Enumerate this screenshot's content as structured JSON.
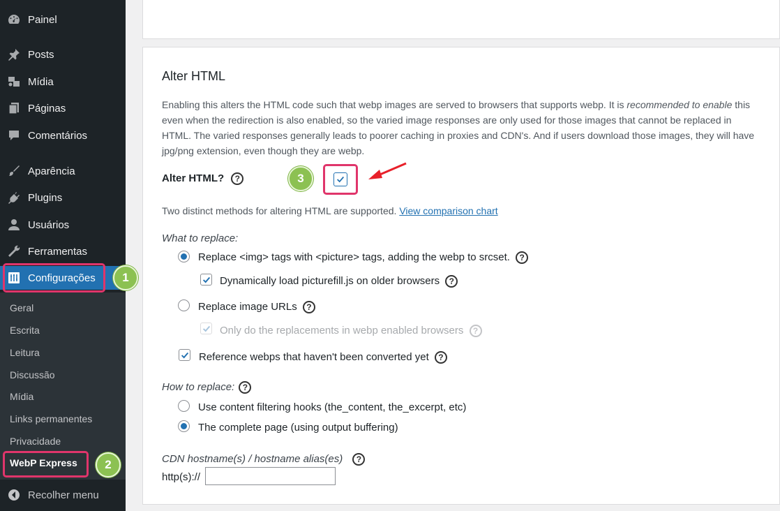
{
  "sidebar": {
    "items": [
      {
        "label": "Painel",
        "icon": "dashboard-icon"
      },
      {
        "label": "Posts",
        "icon": "pin-icon"
      },
      {
        "label": "Mídia",
        "icon": "media-icon"
      },
      {
        "label": "Páginas",
        "icon": "pages-icon"
      },
      {
        "label": "Comentários",
        "icon": "comments-icon"
      },
      {
        "label": "Aparência",
        "icon": "brush-icon"
      },
      {
        "label": "Plugins",
        "icon": "plugin-icon"
      },
      {
        "label": "Usuários",
        "icon": "user-icon"
      },
      {
        "label": "Ferramentas",
        "icon": "wrench-icon"
      },
      {
        "label": "Configurações",
        "icon": "settings-icon"
      }
    ],
    "submenu": [
      "Geral",
      "Escrita",
      "Leitura",
      "Discussão",
      "Mídia",
      "Links permanentes",
      "Privacidade",
      "WebP Express"
    ],
    "collapse_label": "Recolher menu"
  },
  "badges": {
    "one": "1",
    "two": "2",
    "three": "3"
  },
  "section": {
    "title": "Alter HTML",
    "desc_part1": "Enabling this alters the HTML code such that webp images are served to browsers that supports webp. It is ",
    "desc_em": "recommended to enable",
    "desc_part2": " this even when the redirection is also enabled, so the varied image responses are only used for those images that cannot be replaced in HTML. The varied responses generally leads to poorer caching in proxies and CDN's. And if users download those images, they will have jpg/png extension, even though they are webp."
  },
  "alter_html": {
    "label": "Alter HTML?",
    "checked": true
  },
  "methods": {
    "text": "Two distinct methods for altering HTML are supported. ",
    "link": "View comparison chart"
  },
  "what_to_replace": {
    "label": "What to replace:",
    "opt_picture": "Replace <img> tags with <picture> tags, adding the webp to srcset.",
    "opt_picturefill": "Dynamically load picturefill.js on older browsers",
    "opt_urls": "Replace image URLs",
    "opt_only_webp": "Only do the replacements in webp enabled browsers",
    "opt_reference": "Reference webps that haven't been converted yet"
  },
  "how_to_replace": {
    "label": "How to replace:",
    "opt_hooks": "Use content filtering hooks (the_content, the_excerpt, etc)",
    "opt_buffer": "The complete page (using output buffering)"
  },
  "cdn": {
    "label": "CDN hostname(s) / hostname alias(es)",
    "prefix": "http(s)://",
    "value": ""
  },
  "help_glyph": "?",
  "colors": {
    "sidebar": "#1d2327",
    "submenu": "#2c3338",
    "accent": "#2271b1",
    "highlight": "#e0356b",
    "badge": "#8cc152",
    "arrow": "#e8202a"
  }
}
